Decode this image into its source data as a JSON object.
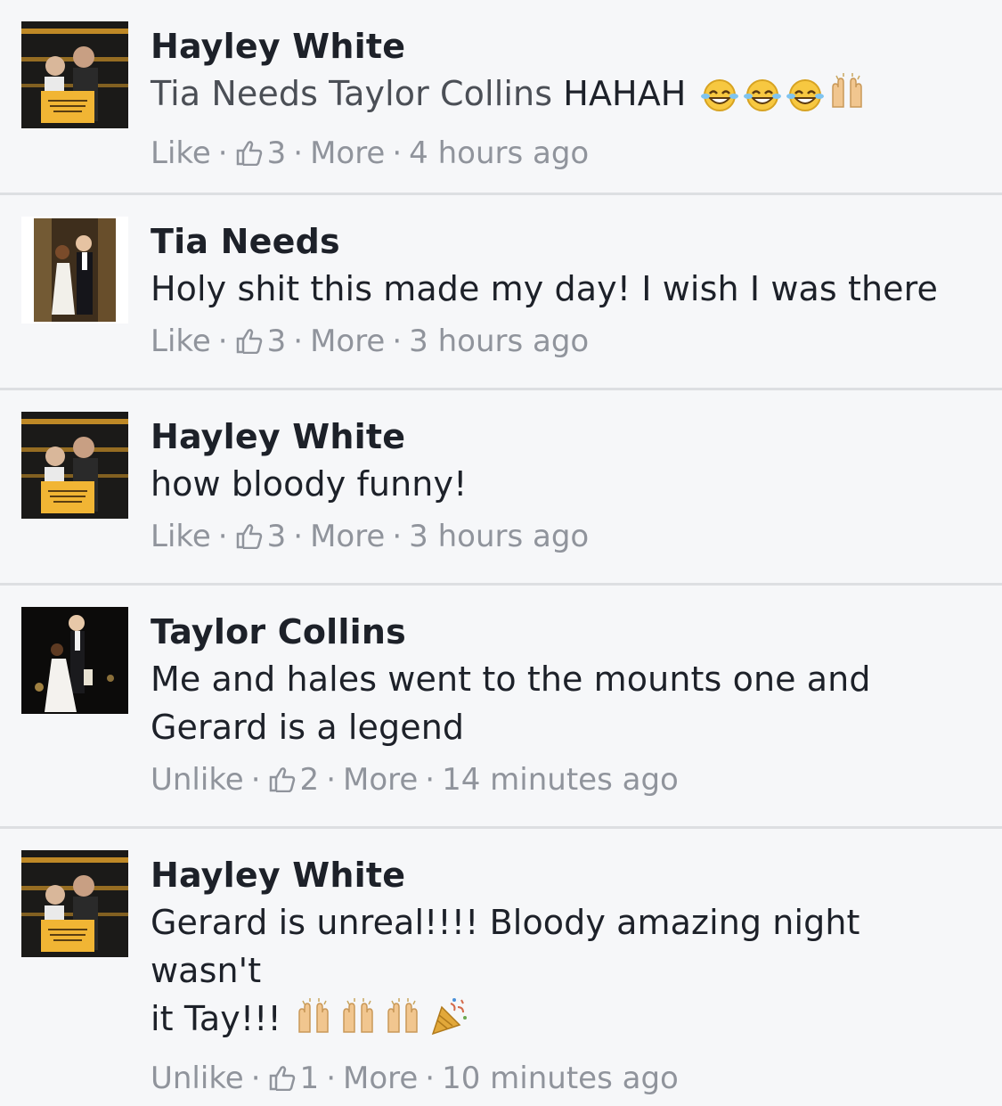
{
  "comments": [
    {
      "author": "Hayley White",
      "text_link": "Tia Needs Taylor Collins",
      "text_rest": " HAHAH",
      "emoji": [
        "tears-of-joy-emoji",
        "tears-of-joy-emoji",
        "tears-of-joy-emoji",
        "raised-hands-emoji"
      ],
      "action": "Like",
      "likes": "3",
      "more": "More",
      "time": "4 hours ago"
    },
    {
      "author": "Tia Needs",
      "text": "Holy shit this made my day! I wish I was there",
      "action": "Like",
      "likes": "3",
      "more": "More",
      "time": "3 hours ago"
    },
    {
      "author": "Hayley White",
      "text": "how bloody funny!",
      "action": "Like",
      "likes": "3",
      "more": "More",
      "time": "3 hours ago"
    },
    {
      "author": "Taylor Collins",
      "text_line1": "Me and hales went to the mounts one and",
      "text_line2": "Gerard is a legend",
      "action": "Unlike",
      "likes": "2",
      "more": "More",
      "time": "14 minutes ago"
    },
    {
      "author": "Hayley White",
      "text_line1": "Gerard is unreal!!!! Bloody amazing night wasn't",
      "text_line2": "it Tay!!!",
      "emoji": [
        "raised-hands-emoji",
        "raised-hands-emoji",
        "raised-hands-emoji",
        "party-popper-emoji"
      ],
      "action": "Unlike",
      "likes": "1",
      "more": "More",
      "time": "10 minutes ago"
    }
  ],
  "colors": {
    "background": "#f6f7f9",
    "divider": "#dddfe2",
    "author": "#1d2129",
    "meta": "#90949c"
  }
}
